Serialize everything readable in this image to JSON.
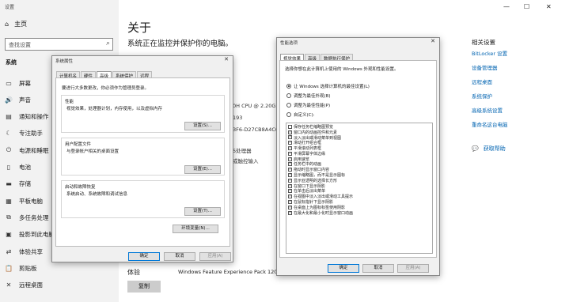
{
  "settings": {
    "window_title": "设置",
    "home": "主页",
    "search_placeholder": "查找设置",
    "section": "系统",
    "nav": [
      "屏幕",
      "声音",
      "通知和操作",
      "专注助手",
      "电源和睡眠",
      "电池",
      "存储",
      "平板电脑",
      "多任务处理",
      "投影到此电脑",
      "体验共享",
      "剪贴板",
      "远程桌面"
    ],
    "about_title": "关于",
    "about_subtitle": "系统正在监控并保护你的电脑。",
    "fragments": [
      "0H CPU @ 2.20GHz",
      "193",
      "3F6-D27CB8A4C6E",
      "5处理器",
      "或触控输入"
    ],
    "edition_label": "体验",
    "edition_value": "Windows Feature Experience Pack 120.2212",
    "copy_button": "复制",
    "related_title": "相关设置",
    "related_links": [
      "BitLocker 设置",
      "设备管理器",
      "远程桌面",
      "系统保护",
      "高级系统设置",
      "重命名这台电脑"
    ],
    "help_link": "获取帮助"
  },
  "sys_props": {
    "title": "系统属性",
    "tabs": [
      "计算机名",
      "硬件",
      "高级",
      "系统保护",
      "远程"
    ],
    "active_tab": "高级",
    "admin_note": "要进行大多数更改，你必须作为管理员登录。",
    "perf_title": "性能",
    "perf_desc": "视觉效果，处理器计划，内存使用，以及虚拟内存",
    "settings_button": "设置(S)...",
    "profile_title": "用户配置文件",
    "profile_desc": "与登录帐户相关的桌面设置",
    "profile_button": "设置(E)...",
    "startup_title": "启动和故障恢复",
    "startup_desc": "系统启动、系统故障和调试信息",
    "startup_button": "设置(T)...",
    "env_button": "环境变量(N)...",
    "ok": "确定",
    "cancel": "取消",
    "apply": "应用(A)"
  },
  "perf_options": {
    "title": "性能选项",
    "tabs": [
      "视觉效果",
      "高级",
      "数据执行保护"
    ],
    "active_tab": "视觉效果",
    "intro": "选择你想在此计算机上使用的 Windows 外观和性能设置。",
    "radios": [
      {
        "label": "让 Windows 选择计算机的最佳设置(L)",
        "selected": true
      },
      {
        "label": "调整为最佳外观(B)",
        "selected": false
      },
      {
        "label": "调整为最佳性能(P)",
        "selected": false
      },
      {
        "label": "自定义(C):",
        "selected": false
      }
    ],
    "checkboxes": [
      {
        "label": "保存任务栏缩略图预览",
        "checked": false
      },
      {
        "label": "窗口内的动画控件和元素",
        "checked": true
      },
      {
        "label": "淡入淡出或滑动菜单到视图",
        "checked": true
      },
      {
        "label": "滑动打开组合框",
        "checked": true
      },
      {
        "label": "平滑滚动列表框",
        "checked": true
      },
      {
        "label": "平滑屏幕字体边缘",
        "checked": true
      },
      {
        "label": "启用速览",
        "checked": true
      },
      {
        "label": "任务栏中的动画",
        "checked": true
      },
      {
        "label": "拖动时显示窗口内容",
        "checked": true
      },
      {
        "label": "显示缩略图，而不是显示图标",
        "checked": true
      },
      {
        "label": "显示亚透明的选择长方形",
        "checked": true
      },
      {
        "label": "在窗口下显示阴影",
        "checked": true
      },
      {
        "label": "在单击后淡出菜单",
        "checked": true
      },
      {
        "label": "在视图中淡入淡出或滑动工具提示",
        "checked": true
      },
      {
        "label": "在鼠标指针下显示阴影",
        "checked": true
      },
      {
        "label": "在桌面上为图标标签使用阴影",
        "checked": true
      },
      {
        "label": "在最大化和最小化时显示窗口动画",
        "checked": true
      }
    ],
    "ok": "确定",
    "cancel": "取消",
    "apply": "应用(A)"
  },
  "icons": {
    "home": "home-icon",
    "search": "search-icon",
    "check": "checkbox-check-icon"
  }
}
